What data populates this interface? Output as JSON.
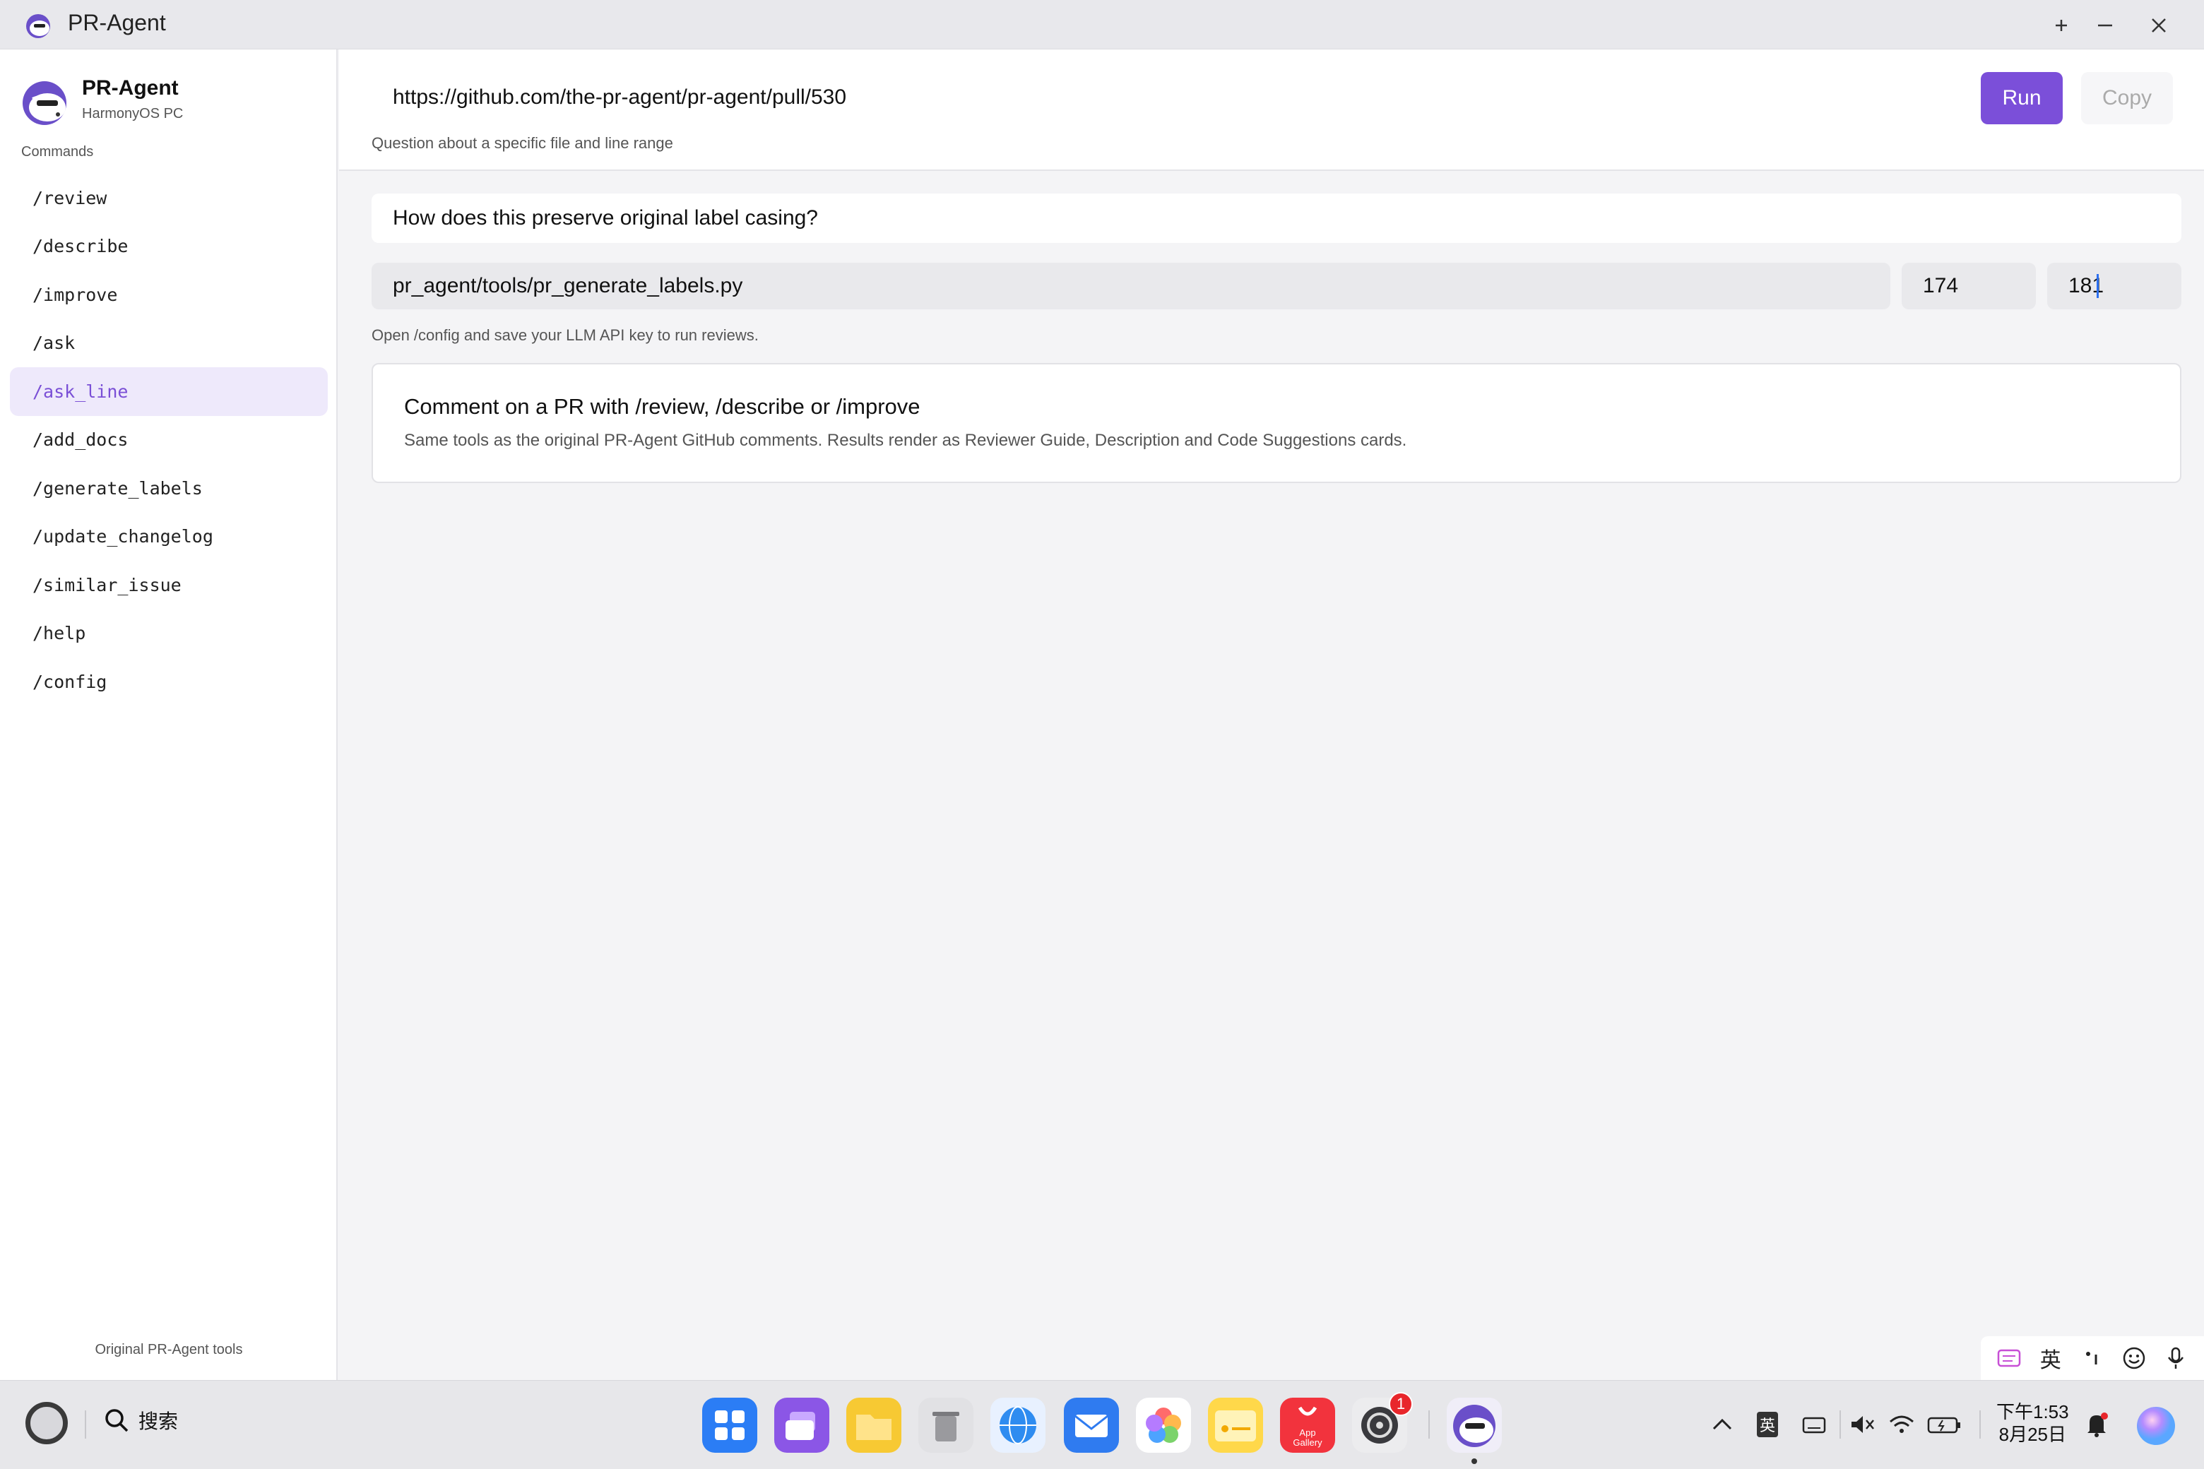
{
  "window": {
    "title": "PR-Agent"
  },
  "sidebar": {
    "brand_name": "PR-Agent",
    "brand_sub": "HarmonyOS PC",
    "section_label": "Commands",
    "items": [
      {
        "label": "/review",
        "active": false
      },
      {
        "label": "/describe",
        "active": false
      },
      {
        "label": "/improve",
        "active": false
      },
      {
        "label": "/ask",
        "active": false
      },
      {
        "label": "/ask_line",
        "active": true
      },
      {
        "label": "/add_docs",
        "active": false
      },
      {
        "label": "/generate_labels",
        "active": false
      },
      {
        "label": "/update_changelog",
        "active": false
      },
      {
        "label": "/similar_issue",
        "active": false
      },
      {
        "label": "/help",
        "active": false
      },
      {
        "label": "/config",
        "active": false
      }
    ],
    "footer": "Original PR-Agent tools"
  },
  "main": {
    "pr_url": "https://github.com/the-pr-agent/pr-agent/pull/530",
    "run_label": "Run",
    "copy_label": "Copy",
    "mode_hint": "Question about a specific file and line range",
    "question": "How does this preserve original label casing?",
    "file_path": "pr_agent/tools/pr_generate_labels.py",
    "line_start": "174",
    "line_end": "181",
    "config_hint": "Open /config and save your LLM API key to run reviews.",
    "info_card": {
      "title": "Comment on a PR with /review, /describe or /improve",
      "description": "Same tools as the original PR-Agent GitHub comments. Results render as Reviewer Guide, Description and Code Suggestions cards."
    }
  },
  "ime_toolbar": {
    "lang": "英"
  },
  "taskbar": {
    "search_label": "搜索",
    "dock_icons": [
      "launcher-icon",
      "multitask-icon",
      "files-icon",
      "trash-icon",
      "browser-icon",
      "mail-icon",
      "photos-icon",
      "notes-icon",
      "app-gallery-icon",
      "settings-icon",
      "pr-agent-icon"
    ],
    "app_gallery_label": "App\nGallery",
    "settings_badge": "1",
    "tray_lang": "英",
    "time": "下午1:53",
    "date": "8月25日"
  },
  "colors": {
    "accent": "#7b4fd9",
    "active_bg": "#eee9fb",
    "active_text": "#7a4fd6"
  }
}
